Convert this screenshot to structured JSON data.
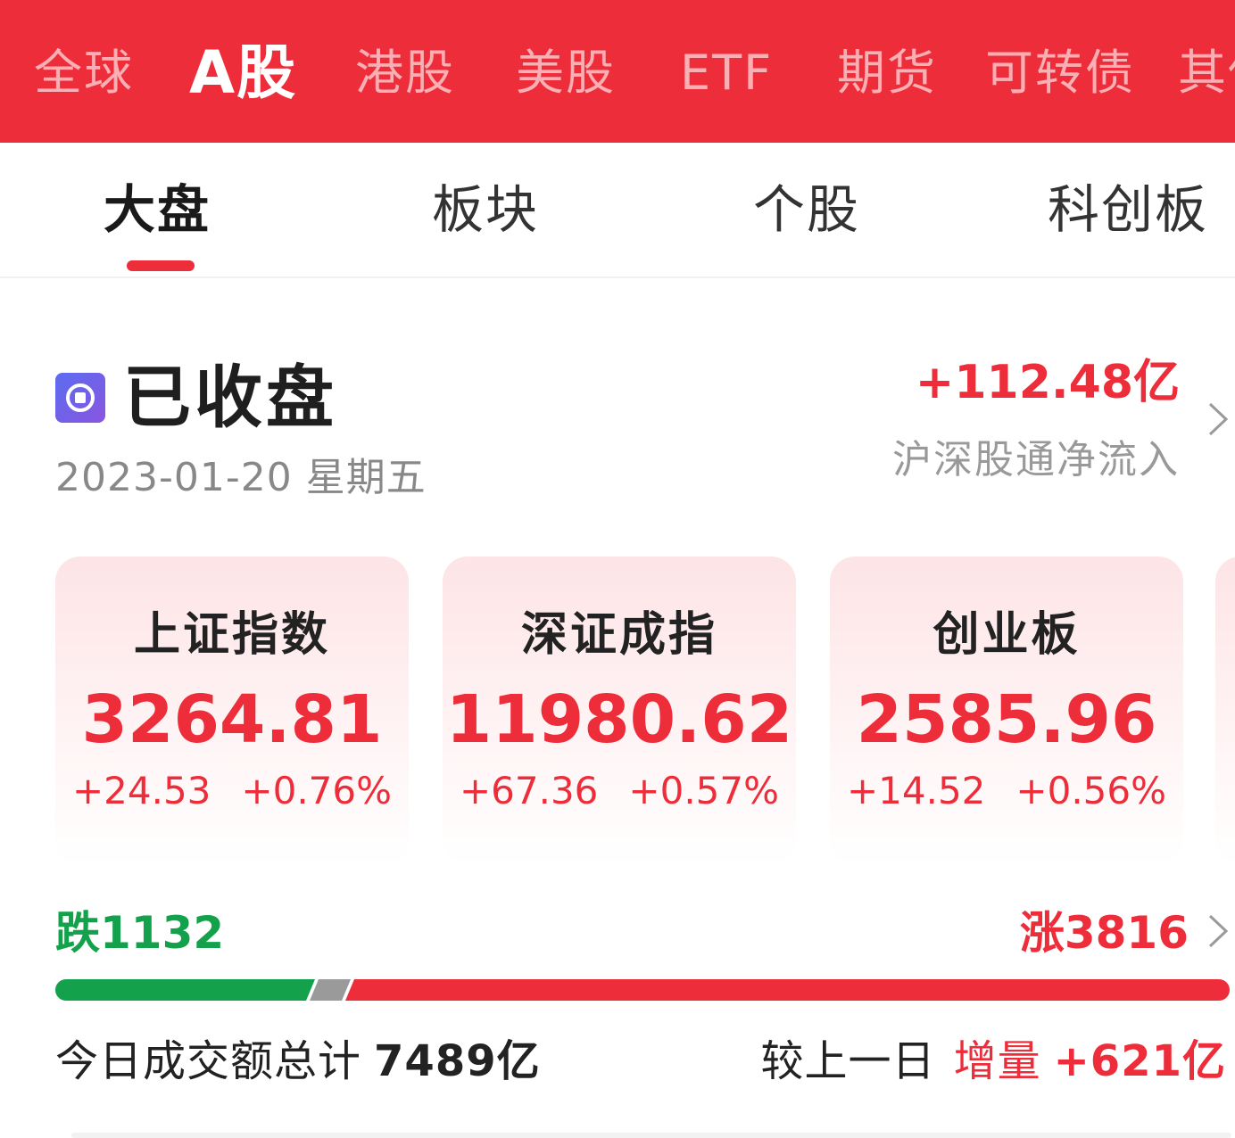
{
  "market_tabs": [
    {
      "label": "全球",
      "active": false
    },
    {
      "label": "A股",
      "active": true
    },
    {
      "label": "港股",
      "active": false
    },
    {
      "label": "美股",
      "active": false
    },
    {
      "label": "ETF",
      "active": false
    },
    {
      "label": "期货",
      "active": false
    },
    {
      "label": "可转债",
      "active": false
    },
    {
      "label": "其他",
      "active": false
    }
  ],
  "sub_tabs": [
    {
      "label": "大盘",
      "active": true
    },
    {
      "label": "板块",
      "active": false
    },
    {
      "label": "个股",
      "active": false
    },
    {
      "label": "科创板",
      "active": false
    }
  ],
  "status": {
    "icon": "market-status-icon",
    "title": "已收盘",
    "date": "2023-01-20 星期五"
  },
  "net_flow": {
    "value": "+112.48亿",
    "label": "沪深股通净流入"
  },
  "indices": [
    {
      "name": "上证指数",
      "price": "3264.81",
      "change": "+24.53",
      "change_pct": "+0.76%"
    },
    {
      "name": "深证成指",
      "price": "11980.62",
      "change": "+67.36",
      "change_pct": "+0.57%"
    },
    {
      "name": "创业板",
      "price": "2585.96",
      "change": "+14.52",
      "change_pct": "+0.56%"
    }
  ],
  "breadth": {
    "fall_label": "跌1132",
    "rise_label": "涨3816",
    "fall_count": 1132,
    "rise_count": 3816
  },
  "turnover": {
    "label": "今日成交额总计",
    "value": "7489亿",
    "compare_label": "较上一日",
    "delta_label": "增量",
    "delta_value": "+621亿"
  },
  "colors": {
    "brand_red": "#ee2d3a",
    "fall_green": "#13a24b",
    "flat_gray": "#9a9a9a"
  }
}
